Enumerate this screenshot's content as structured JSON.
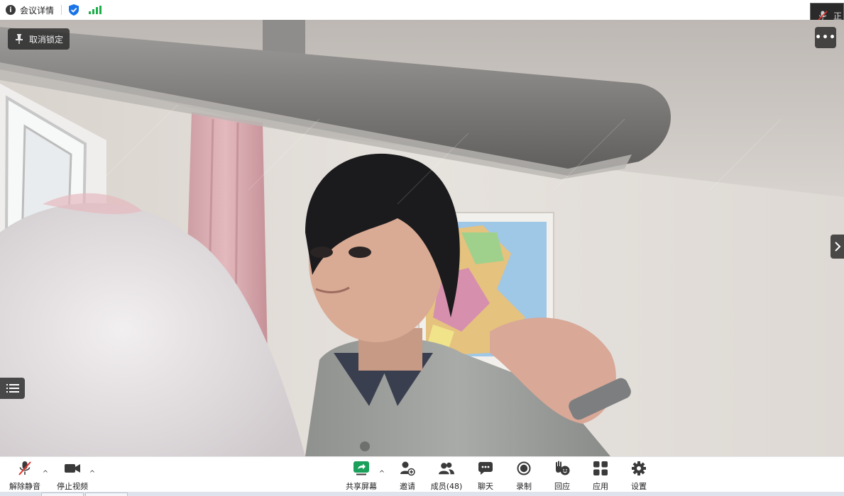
{
  "topbar": {
    "meeting_details_label": "会议详情"
  },
  "top_right": {
    "partial_label": "正"
  },
  "video": {
    "unpin_label": "取消锁定",
    "more_label": "•••"
  },
  "toolbar": {
    "unmute_label": "解除静音",
    "stop_video_label": "停止视频",
    "share_screen_label": "共享屏幕",
    "invite_label": "邀请",
    "participants_label": "成员(48)",
    "chat_label": "聊天",
    "record_label": "录制",
    "reactions_label": "回应",
    "apps_label": "应用",
    "settings_label": "设置"
  },
  "colors": {
    "signal_green": "#1fae4a",
    "shield_blue": "#1a73e8",
    "share_green": "#1aa05a",
    "mic_muted_red": "#e0332c"
  }
}
